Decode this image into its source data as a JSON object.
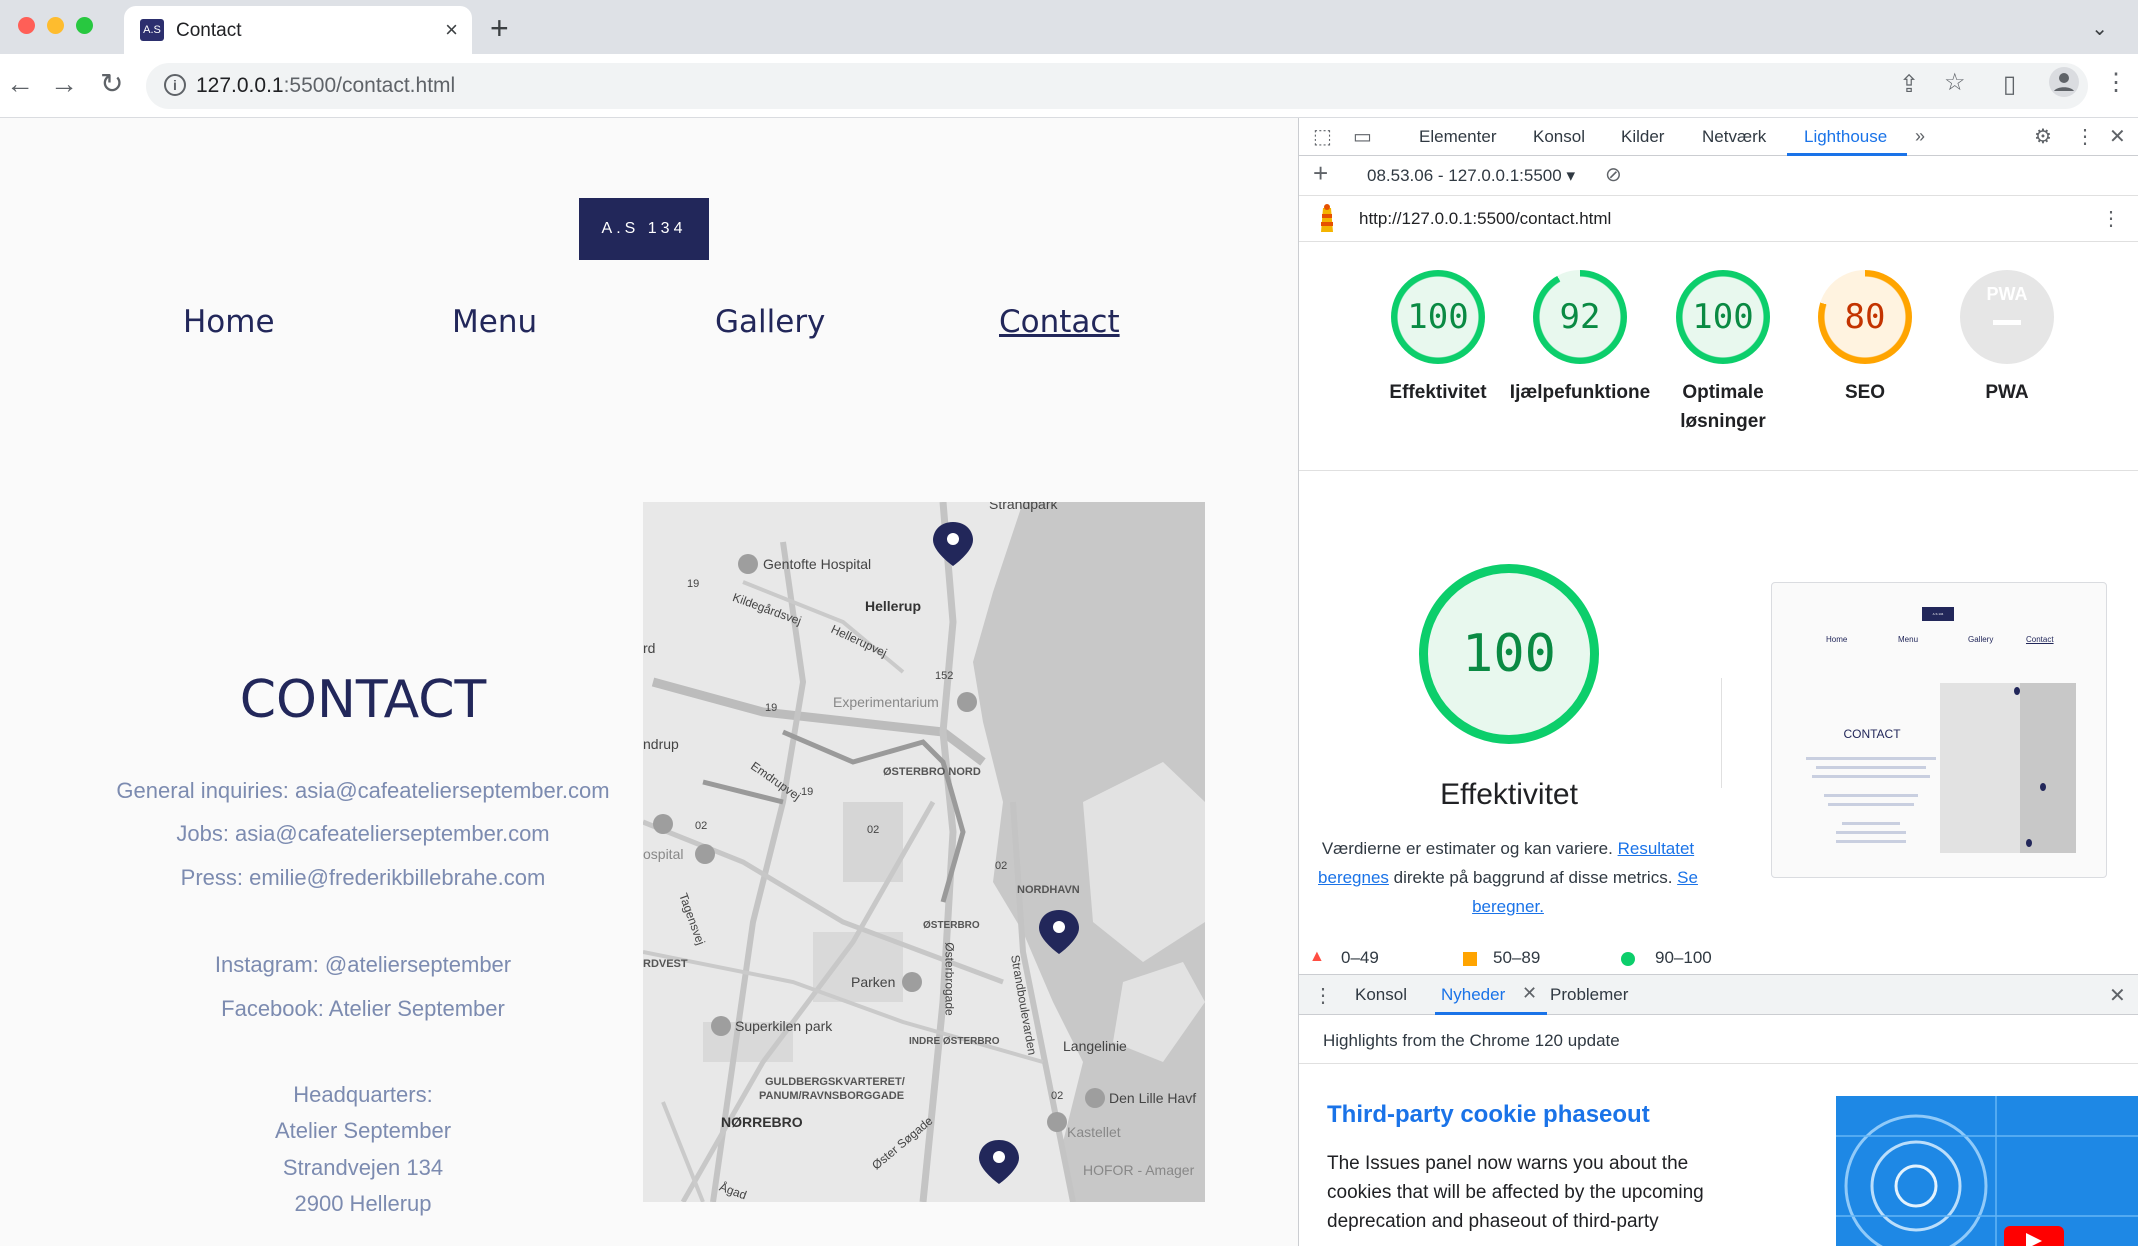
{
  "browser": {
    "tab_title": "Contact",
    "tab_favicon_text": "A.S",
    "url_host": "127.0.0.1",
    "url_rest": ":5500/contact.html"
  },
  "site": {
    "logo": "A.S 134",
    "nav": [
      {
        "label": "Home"
      },
      {
        "label": "Menu"
      },
      {
        "label": "Gallery"
      },
      {
        "label": "Contact"
      }
    ],
    "heading": "CONTACT",
    "contact_lines": [
      "General inquiries: asia@cafeatelierseptember.com",
      "Jobs: asia@cafeatelierseptember.com",
      "Press: emilie@frederikbillebrahe.com",
      "Instagram: @atelierseptember",
      "Facebook: Atelier September",
      "Headquarters:",
      "Atelier September",
      "Strandvejen 134",
      "2900 Hellerup"
    ],
    "map_labels": {
      "strandpark": "Strandpark",
      "gentofte": "Gentofte Hospital",
      "hellerup": "Hellerup",
      "kildegard": "Kildegårdsvej",
      "hellerupvej": "Hellerupvej",
      "experimentarium": "Experimentarium",
      "osterbro_nord": "ØSTERBRO NORD",
      "nordhavn": "NORDHAVN",
      "osterbro": "ØSTERBRO",
      "parken": "Parken",
      "superkilen": "Superkilen park",
      "indre_osterbro": "INDRE ØSTERBRO",
      "langelinie": "Langelinie",
      "guldbergs1": "GULDBERGSKVARTERET/",
      "guldbergs2": "PANUM/RAVNSBORGGADE",
      "norrebro": "NØRREBRO",
      "lille_havf": "Den Lille Havf",
      "kastellet": "Kastellet",
      "hofor": "HOFOR - Amager",
      "ospital": "ospital",
      "ndrup": "ndrup",
      "rd": "rd",
      "rdvest": "RDVEST",
      "r19a": "19",
      "r19b": "19",
      "r19c": "19",
      "r152": "152",
      "r02a": "02",
      "r02b": "02",
      "r02c": "02",
      "r02d": "02",
      "emdrupvej": "Emdrupvej",
      "tagensvej": "Tagensvej",
      "osterbrogade": "Østerbrogade",
      "strandboulevarden": "Strandboulevarden",
      "oster_sogade": "Øster Søgade",
      "agade": "Ågad"
    }
  },
  "devtools": {
    "tabs": [
      "Elementer",
      "Konsol",
      "Kilder",
      "Netværk",
      "Lighthouse"
    ],
    "active_tab": "Lighthouse",
    "report_selector": "08.53.06 - 127.0.0.1:5500",
    "report_url": "http://127.0.0.1:5500/contact.html",
    "scores": [
      {
        "value": "100",
        "label": "Effektivitet",
        "color": "#0cce6b",
        "fraction": 1.0
      },
      {
        "value": "92",
        "label": "Ijælpefunktione",
        "color": "#0cce6b",
        "fraction": 0.92
      },
      {
        "value": "100",
        "label": "Optimale løsninger",
        "color": "#0cce6b",
        "fraction": 1.0
      },
      {
        "value": "80",
        "label": "SEO",
        "color": "#ffa400",
        "fraction": 0.8
      },
      {
        "value": "PWA",
        "label": "PWA",
        "color": "#cccccc",
        "fraction": 0
      }
    ],
    "performance": {
      "score": "100",
      "title": "Effektivitet",
      "desc_1": "Værdierne er estimater og kan variere.",
      "link_1": "Resultatet beregnes",
      "desc_2": "direkte på baggrund af disse metrics.",
      "link_2": "Se beregner."
    },
    "thumb": {
      "logo": "A.S 134",
      "nav": [
        "Home",
        "Menu",
        "Gallery",
        "Contact"
      ],
      "heading": "CONTACT"
    },
    "legend": [
      "0–49",
      "50–89",
      "90–100"
    ],
    "drawer": {
      "tabs": [
        "Konsol",
        "Nyheder",
        "Problemer"
      ],
      "active_tab": "Nyheder",
      "highlights": "Highlights from the Chrome 120 update",
      "news_title": "Third-party cookie phaseout",
      "news_body": "The Issues panel now warns you about the cookies that will be affected by the upcoming deprecation and phaseout of third-party"
    }
  }
}
